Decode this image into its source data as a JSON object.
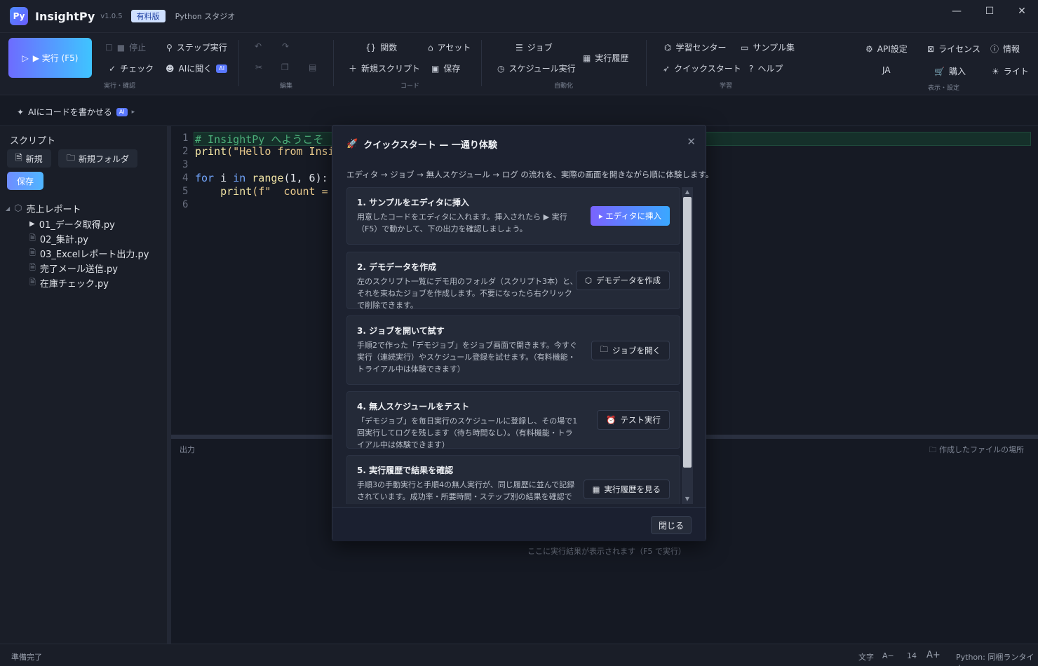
{
  "app": {
    "logo": "Py",
    "name": "InsightPy",
    "version": "v1.0.5",
    "edition": "有料版",
    "subtitle": "Python スタジオ"
  },
  "window_controls": [
    "—",
    "☐",
    "✕"
  ],
  "ribbon": {
    "run": "▶ 実行 (F5)",
    "stop": "停止",
    "step": "ステップ実行",
    "check": "チェック",
    "ask_ai": "AIに聞く",
    "ai_tag": "AI",
    "group_run": "実行・確認",
    "group_edit": "編集",
    "functions": "関数",
    "assets": "アセット",
    "new_script": "新規スクリプト",
    "save": "保存",
    "group_code": "コード",
    "jobs": "ジョブ",
    "schedule_run": "スケジュール実行",
    "history": "実行履歴",
    "group_automation": "自動化",
    "learning_center": "学習センター",
    "samples": "サンプル集",
    "quickstart": "クイックスタート",
    "help": "ヘルプ",
    "group_learning": "学習",
    "api_settings": "API設定",
    "license": "ライセンス",
    "info": "情報",
    "language": "JA",
    "purchase": "購入",
    "theme": "ライト",
    "group_display": "表示・設定"
  },
  "aibar": {
    "label": "AIにコードを書かせる",
    "tag": "AI",
    "arrow": "▸"
  },
  "sidebar": {
    "title": "スクリプト",
    "new": "新規",
    "new_folder": "新規フォルダ",
    "save": "保存",
    "folder": "売上レポート",
    "files": [
      "01_データ取得.py",
      "02_集計.py",
      "03_Excelレポート出力.py",
      "完了メール送信.py",
      "在庫チェック.py"
    ]
  },
  "editor": {
    "line_numbers": [
      "1",
      "2",
      "3",
      "4",
      "5",
      "6"
    ],
    "line1": "# InsightPy へようこそ",
    "line2_fn": "print",
    "line2_rest": "(\"Hello from Insi",
    "line4_kw1": "for",
    "line4_mid": " i ",
    "line4_kw2": "in",
    "line4_fn": " range",
    "line4_rest": "(1, 6):",
    "line5_fn": "    print",
    "line5_rest": "(f\"  count ="
  },
  "output": {
    "label": "出力",
    "files_link": "作成したファイルの場所",
    "hint": "ここに実行結果が表示されます（F5 で実行）"
  },
  "status": {
    "ready": "準備完了",
    "font_label": "文字",
    "font_minus": "A−",
    "font_size": "14",
    "font_plus": "A+",
    "runtime": "Python: 同梱ランタイム"
  },
  "modal": {
    "title": "クイックスタート — 一通り体験",
    "description": "エディタ → ジョブ → 無人スケジュール → ログ の流れを、実際の画面を開きながら順に体験します。",
    "close_label": "閉じる",
    "steps": [
      {
        "title": "1. サンプルをエディタに挿入",
        "desc": "用意したコードをエディタに入れます。挿入されたら ▶ 実行（F5）で動かして、下の出力を確認しましょう。",
        "button": "▸ エディタに挿入"
      },
      {
        "title": "2. デモデータを作成",
        "desc": "左のスクリプト一覧にデモ用のフォルダ（スクリプト3本）と、それを束ねたジョブを作成します。不要になったら右クリックで削除できます。",
        "button": "デモデータを作成"
      },
      {
        "title": "3. ジョブを開いて試す",
        "desc": "手順2で作った「デモジョブ」をジョブ画面で開きます。今すぐ実行（連続実行）やスケジュール登録を試せます。（有料機能・トライアル中は体験できます）",
        "button": "ジョブを開く"
      },
      {
        "title": "4. 無人スケジュールをテスト",
        "desc": "「デモジョブ」を毎日実行のスケジュールに登録し、その場で1回実行してログを残します（待ち時間なし）。（有料機能・トライアル中は体験できます）",
        "button": "テスト実行"
      },
      {
        "title": "5. 実行履歴で結果を確認",
        "desc": "手順3の手動実行と手順4の無人実行が、同じ履歴に並んで記録されています。成功率・所要時間・ステップ別の結果を確認できます",
        "button": "実行履歴を見る"
      }
    ]
  }
}
